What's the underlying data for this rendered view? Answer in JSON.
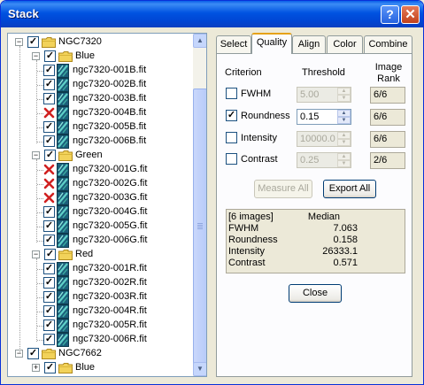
{
  "window": {
    "title": "Stack",
    "help_glyph": "?",
    "close_glyph": "✕"
  },
  "tree": {
    "nodes": [
      {
        "label": "NGC7320",
        "kind": "group",
        "level": 0,
        "expander": "−",
        "checked": true
      },
      {
        "label": "Blue",
        "kind": "folder",
        "level": 1,
        "expander": "−",
        "checked": true
      },
      {
        "label": "ngc7320-001B.fit",
        "kind": "file",
        "level": 2,
        "checked": true
      },
      {
        "label": "ngc7320-002B.fit",
        "kind": "file",
        "level": 2,
        "checked": true
      },
      {
        "label": "ngc7320-003B.fit",
        "kind": "file",
        "level": 2,
        "checked": true
      },
      {
        "label": "ngc7320-004B.fit",
        "kind": "file",
        "level": 2,
        "checked": false,
        "rejected": true
      },
      {
        "label": "ngc7320-005B.fit",
        "kind": "file",
        "level": 2,
        "checked": true
      },
      {
        "label": "ngc7320-006B.fit",
        "kind": "file",
        "level": 2,
        "checked": true
      },
      {
        "label": "Green",
        "kind": "folder",
        "level": 1,
        "expander": "−",
        "checked": true
      },
      {
        "label": "ngc7320-001G.fit",
        "kind": "file",
        "level": 2,
        "checked": false,
        "rejected": true
      },
      {
        "label": "ngc7320-002G.fit",
        "kind": "file",
        "level": 2,
        "checked": false,
        "rejected": true
      },
      {
        "label": "ngc7320-003G.fit",
        "kind": "file",
        "level": 2,
        "checked": false,
        "rejected": true
      },
      {
        "label": "ngc7320-004G.fit",
        "kind": "file",
        "level": 2,
        "checked": true
      },
      {
        "label": "ngc7320-005G.fit",
        "kind": "file",
        "level": 2,
        "checked": true
      },
      {
        "label": "ngc7320-006G.fit",
        "kind": "file",
        "level": 2,
        "checked": true
      },
      {
        "label": "Red",
        "kind": "folder",
        "level": 1,
        "expander": "−",
        "checked": true
      },
      {
        "label": "ngc7320-001R.fit",
        "kind": "file",
        "level": 2,
        "checked": true
      },
      {
        "label": "ngc7320-002R.fit",
        "kind": "file",
        "level": 2,
        "checked": true
      },
      {
        "label": "ngc7320-003R.fit",
        "kind": "file",
        "level": 2,
        "checked": true
      },
      {
        "label": "ngc7320-004R.fit",
        "kind": "file",
        "level": 2,
        "checked": true
      },
      {
        "label": "ngc7320-005R.fit",
        "kind": "file",
        "level": 2,
        "checked": true
      },
      {
        "label": "ngc7320-006R.fit",
        "kind": "file",
        "level": 2,
        "checked": true
      },
      {
        "label": "NGC7662",
        "kind": "group",
        "level": 0,
        "expander": "−",
        "checked": true
      },
      {
        "label": "Blue",
        "kind": "folder",
        "level": 1,
        "expander": "+",
        "checked": true
      }
    ]
  },
  "tabs": [
    {
      "label": "Select",
      "active": false
    },
    {
      "label": "Quality",
      "active": true
    },
    {
      "label": "Align",
      "active": false
    },
    {
      "label": "Color",
      "active": false
    },
    {
      "label": "Combine",
      "active": false
    }
  ],
  "quality": {
    "headers": {
      "criterion": "Criterion",
      "threshold": "Threshold",
      "rank": "Image\nRank"
    },
    "criteria": [
      {
        "label": "FWHM",
        "checked": false,
        "threshold": "5.00",
        "enabled": false,
        "rank": "6/6"
      },
      {
        "label": "Roundness",
        "checked": true,
        "threshold": "0.15",
        "enabled": true,
        "rank": "6/6"
      },
      {
        "label": "Intensity",
        "checked": false,
        "threshold": "10000.0",
        "enabled": false,
        "rank": "6/6"
      },
      {
        "label": "Contrast",
        "checked": false,
        "threshold": "0.25",
        "enabled": false,
        "rank": "2/6"
      }
    ],
    "measure_all_label": "Measure All",
    "export_all_label": "Export All",
    "stats": {
      "header_left": "[6 images]",
      "header_right": "Median",
      "rows": [
        {
          "name": "FWHM",
          "value": "7.063"
        },
        {
          "name": "Roundness",
          "value": "0.158"
        },
        {
          "name": "Intensity",
          "value": "26333.1"
        },
        {
          "name": "Contrast",
          "value": "0.571"
        }
      ]
    },
    "close_label": "Close"
  },
  "colors": {
    "titlebar": "#0053e1",
    "tab_highlight": "#e6a219",
    "reject_x": "#d02020",
    "folder": "#f2d25a"
  }
}
